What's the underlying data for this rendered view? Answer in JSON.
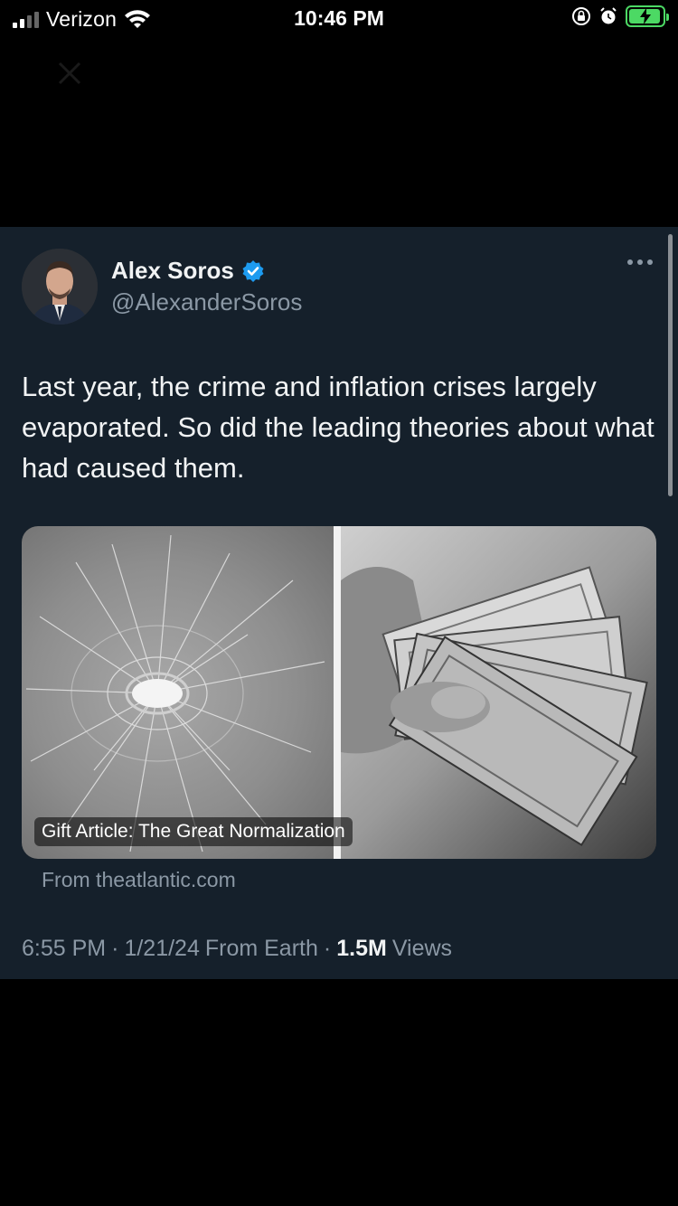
{
  "status_bar": {
    "carrier": "Verizon",
    "time": "10:46 PM"
  },
  "tweet": {
    "author_name": "Alex Soros",
    "author_handle": "@AlexanderSoros",
    "verified": true,
    "text": "Last year, the crime and inflation crises largely evaporated. So did the leading theories about what had caused them.",
    "media": {
      "caption": "Gift Article: The Great Normalization",
      "source": "From theatlantic.com"
    },
    "meta": {
      "time": "6:55 PM",
      "sep1": "·",
      "date": "1/21/24",
      "client": "From Earth",
      "sep2": "·",
      "views_count": "1.5M",
      "views_label": "Views"
    }
  },
  "colors": {
    "card_bg": "#15202b",
    "verified_blue": "#1d9bf0",
    "battery_green": "#4cd964",
    "muted_text": "#8b98a5"
  }
}
